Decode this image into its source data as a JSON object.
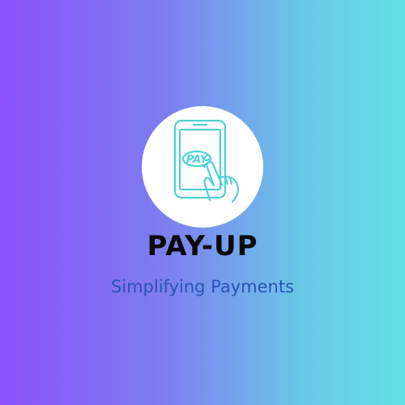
{
  "brand": {
    "name": "PAY-UP",
    "tagline": "Simplifying Payments"
  },
  "logo": {
    "icon": "phone-pay-tap-icon",
    "button_text": "PAY",
    "stroke_color": "#4fd0d4"
  },
  "colors": {
    "gradient_start": "#8c50fa",
    "gradient_end": "#62e0e4",
    "brand_text": "#0b0b0b",
    "tagline_text": "#2a53b4"
  }
}
